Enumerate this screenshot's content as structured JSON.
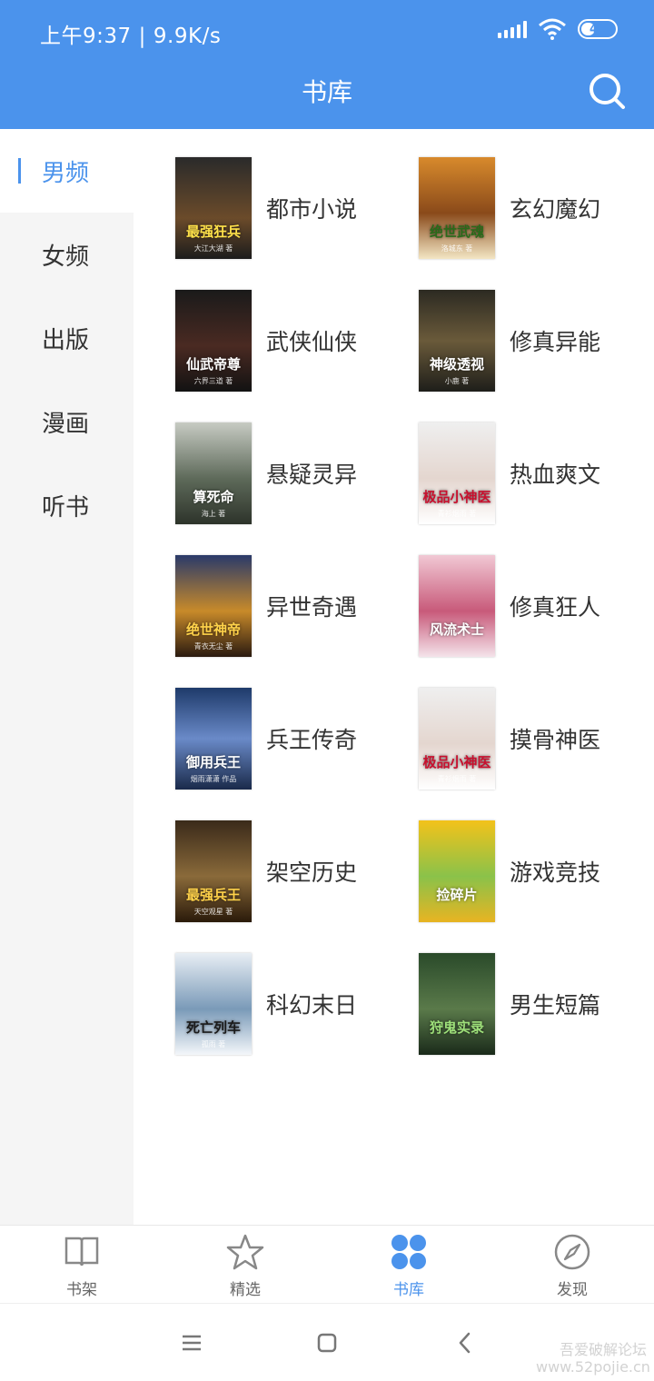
{
  "status_bar": {
    "time": "上午9:37",
    "net_speed": "9.9K/s",
    "battery": "41",
    "battery_level": 0.41
  },
  "header": {
    "title": "书库",
    "search_icon": "search-icon"
  },
  "sidebar": {
    "items": [
      {
        "label": "男频",
        "active": true
      },
      {
        "label": "女频",
        "active": false
      },
      {
        "label": "出版",
        "active": false
      },
      {
        "label": "漫画",
        "active": false
      },
      {
        "label": "听书",
        "active": false
      }
    ]
  },
  "categories": [
    {
      "label": "都市小说",
      "cover_title": "最强狂兵",
      "cover_sub": "大江大湖 著"
    },
    {
      "label": "玄幻魔幻",
      "cover_title": "绝世武魂",
      "cover_sub": "洛城东 著"
    },
    {
      "label": "武侠仙侠",
      "cover_title": "仙武帝尊",
      "cover_sub": "六界三道 著"
    },
    {
      "label": "修真异能",
      "cover_title": "神级透视",
      "cover_sub": "小鹿 著"
    },
    {
      "label": "悬疑灵异",
      "cover_title": "算死命",
      "cover_sub": "海上 著"
    },
    {
      "label": "热血爽文",
      "cover_title": "极品小神医",
      "cover_sub": "青衫烟雨 著"
    },
    {
      "label": "异世奇遇",
      "cover_title": "绝世神帝",
      "cover_sub": "青衣无尘 著"
    },
    {
      "label": "修真狂人",
      "cover_title": "风流术士",
      "cover_sub": ""
    },
    {
      "label": "兵王传奇",
      "cover_title": "御用兵王",
      "cover_sub": "烟雨潇潇 作品"
    },
    {
      "label": "摸骨神医",
      "cover_title": "极品小神医",
      "cover_sub": "青衫烟雨 著"
    },
    {
      "label": "架空历史",
      "cover_title": "最强兵王",
      "cover_sub": "天空观星 著"
    },
    {
      "label": "游戏竞技",
      "cover_title": "捡碎片",
      "cover_sub": ""
    },
    {
      "label": "科幻末日",
      "cover_title": "死亡列车",
      "cover_sub": "孤雨 著"
    },
    {
      "label": "男生短篇",
      "cover_title": "狩鬼实录",
      "cover_sub": ""
    }
  ],
  "tabbar": {
    "items": [
      {
        "label": "书架",
        "icon": "book-icon",
        "active": false
      },
      {
        "label": "精选",
        "icon": "star-icon",
        "active": false
      },
      {
        "label": "书库",
        "icon": "grid-dots-icon",
        "active": true
      },
      {
        "label": "发现",
        "icon": "compass-icon",
        "active": false
      }
    ]
  },
  "system_nav": {
    "menu_icon": "menu-icon",
    "home_icon": "home-icon",
    "back_icon": "back-icon"
  },
  "watermark": "吾爱破解论坛 www.52pojie.cn",
  "colors": {
    "accent": "#4b93ec",
    "sidebar_bg": "#f5f5f5",
    "text": "#333333"
  }
}
